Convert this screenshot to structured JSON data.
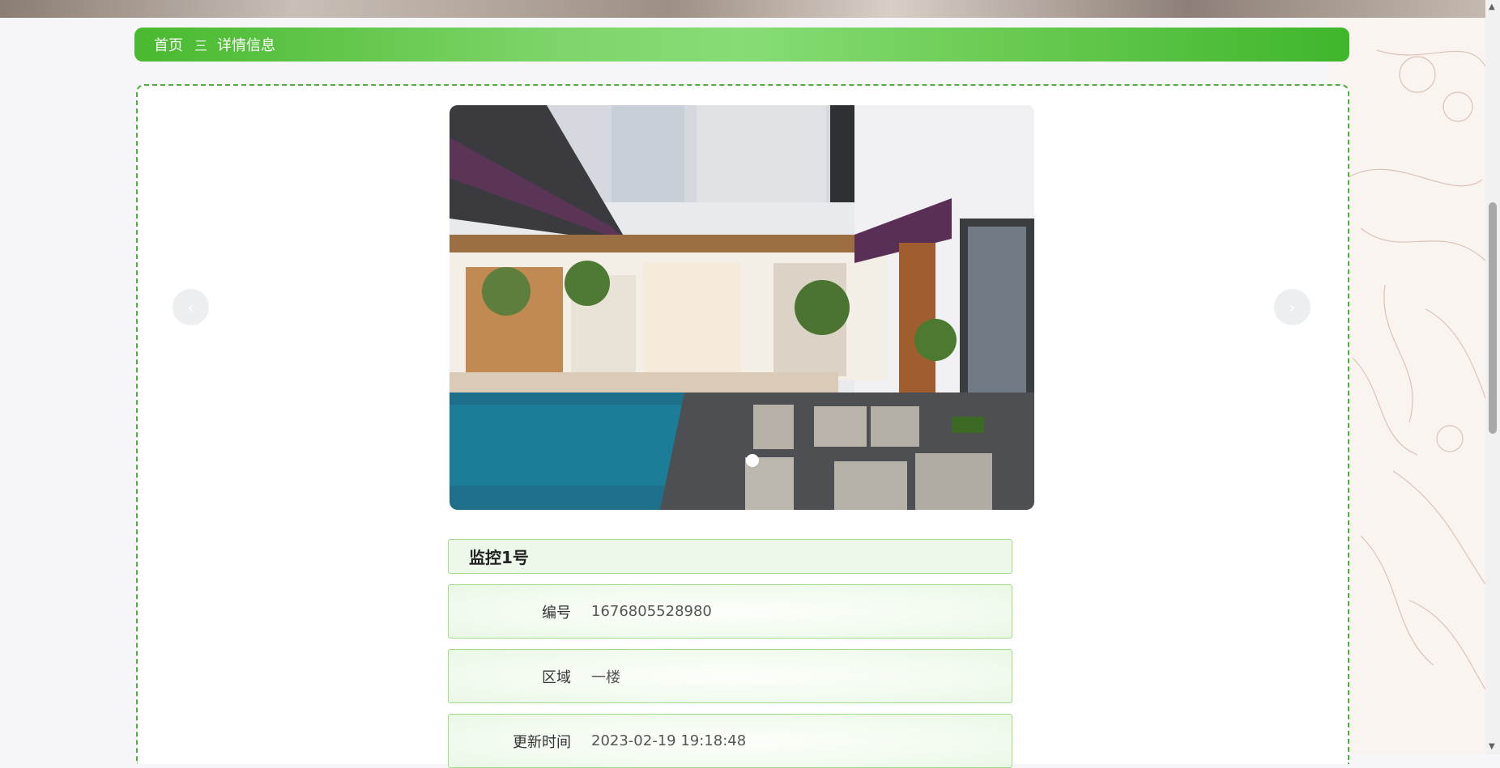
{
  "breadcrumb": {
    "home": "首页",
    "separator": "三",
    "current": "详情信息"
  },
  "carousel": {
    "prev": "‹",
    "next": "›",
    "active_index": 1,
    "total": 1
  },
  "detail": {
    "title": "监控1号",
    "fields": [
      {
        "label": "编号",
        "value": "1676805528980"
      },
      {
        "label": "区域",
        "value": "一楼"
      },
      {
        "label": "更新时间",
        "value": "2023-02-19 19:18:48"
      }
    ]
  },
  "icons": {
    "scroll_up": "scroll-up-arrow-icon",
    "scroll_down": "scroll-down-arrow-icon"
  },
  "colors": {
    "accent": "#49b92f",
    "border": "#9cdc8a"
  }
}
